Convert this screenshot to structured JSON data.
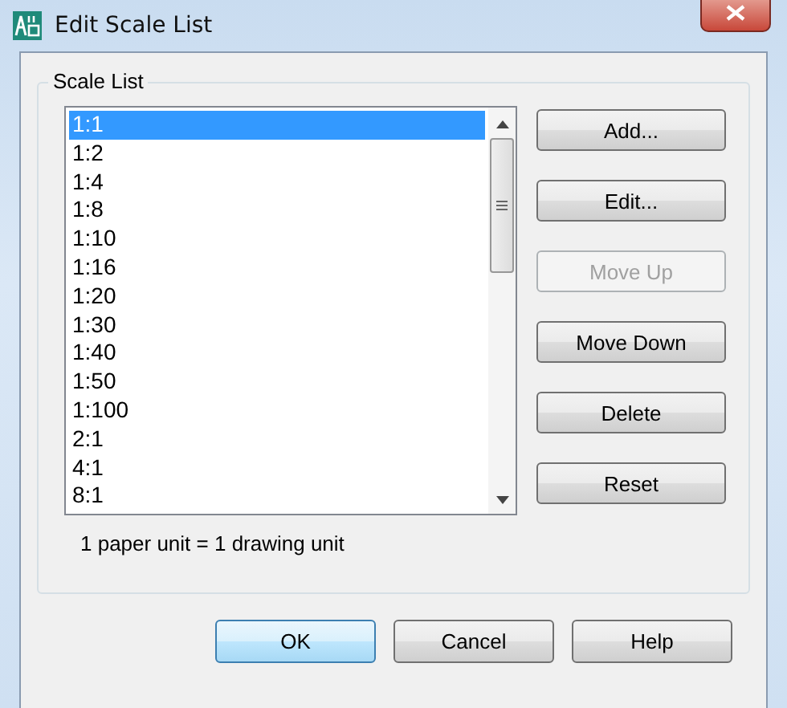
{
  "window": {
    "title": "Edit Scale List"
  },
  "group": {
    "label": "Scale List"
  },
  "scales": [
    {
      "label": "1:1",
      "selected": true
    },
    {
      "label": "1:2",
      "selected": false
    },
    {
      "label": "1:4",
      "selected": false
    },
    {
      "label": "1:8",
      "selected": false
    },
    {
      "label": "1:10",
      "selected": false
    },
    {
      "label": "1:16",
      "selected": false
    },
    {
      "label": "1:20",
      "selected": false
    },
    {
      "label": "1:30",
      "selected": false
    },
    {
      "label": "1:40",
      "selected": false
    },
    {
      "label": "1:50",
      "selected": false
    },
    {
      "label": "1:100",
      "selected": false
    },
    {
      "label": "2:1",
      "selected": false
    },
    {
      "label": "4:1",
      "selected": false
    },
    {
      "label": "8:1",
      "selected": false
    }
  ],
  "side_buttons": [
    {
      "label": "Add...",
      "disabled": false
    },
    {
      "label": "Edit...",
      "disabled": false
    },
    {
      "label": "Move Up",
      "disabled": true
    },
    {
      "label": "Move Down",
      "disabled": false
    },
    {
      "label": "Delete",
      "disabled": false
    },
    {
      "label": "Reset",
      "disabled": false
    }
  ],
  "unit_text": "1 paper unit = 1 drawing unit",
  "footer_buttons": [
    {
      "label": "OK",
      "default": true
    },
    {
      "label": "Cancel",
      "default": false
    },
    {
      "label": "Help",
      "default": false
    }
  ]
}
